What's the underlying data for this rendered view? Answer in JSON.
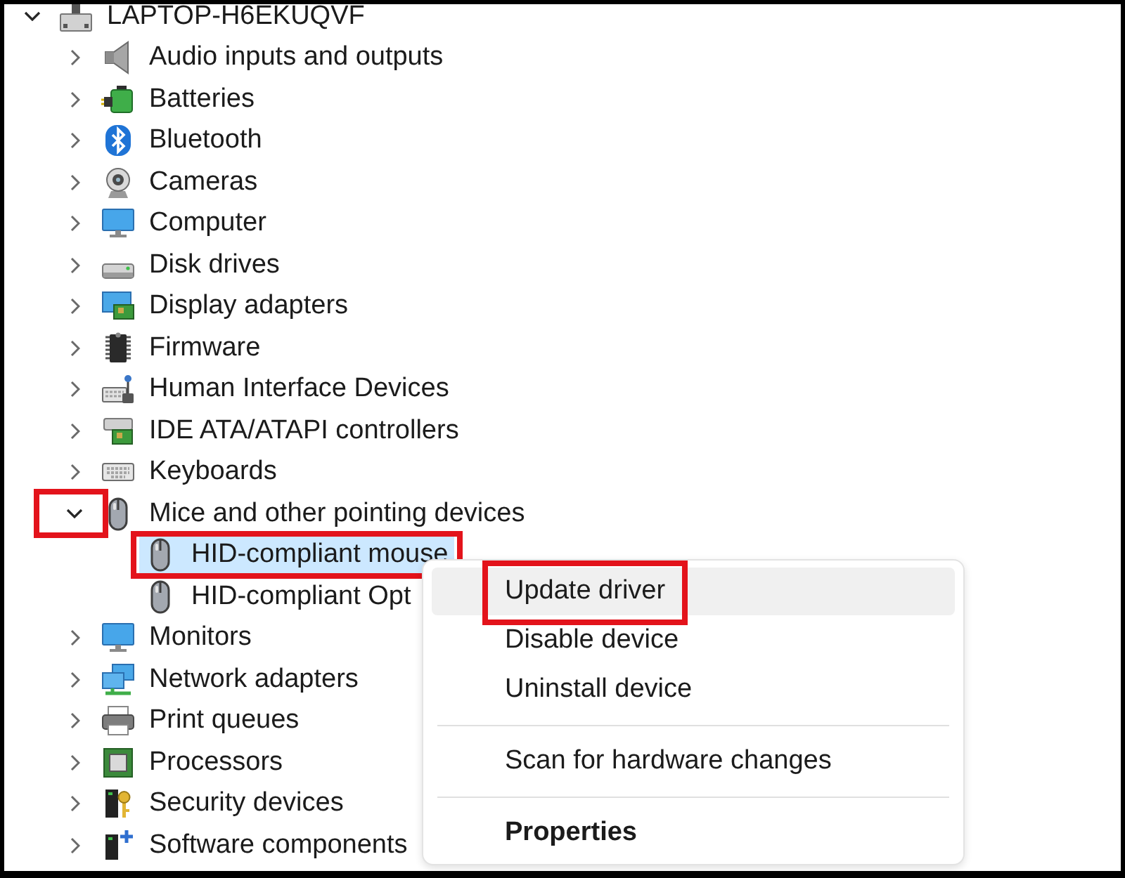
{
  "tree": {
    "label": "LAPTOP-H6EKUQVF",
    "expanded": true,
    "selected": false,
    "toggle_callout": false,
    "callout": false,
    "children": [
      {
        "label": "Audio inputs and outputs",
        "expanded": false,
        "selected": false,
        "toggle_callout": false,
        "callout": false
      },
      {
        "label": "Batteries",
        "expanded": false,
        "selected": false,
        "toggle_callout": false,
        "callout": false
      },
      {
        "label": "Bluetooth",
        "expanded": false,
        "selected": false,
        "toggle_callout": false,
        "callout": false
      },
      {
        "label": "Cameras",
        "expanded": false,
        "selected": false,
        "toggle_callout": false,
        "callout": false
      },
      {
        "label": "Computer",
        "expanded": false,
        "selected": false,
        "toggle_callout": false,
        "callout": false
      },
      {
        "label": "Disk drives",
        "expanded": false,
        "selected": false,
        "toggle_callout": false,
        "callout": false
      },
      {
        "label": "Display adapters",
        "expanded": false,
        "selected": false,
        "toggle_callout": false,
        "callout": false
      },
      {
        "label": "Firmware",
        "expanded": false,
        "selected": false,
        "toggle_callout": false,
        "callout": false
      },
      {
        "label": "Human Interface Devices",
        "expanded": false,
        "selected": false,
        "toggle_callout": false,
        "callout": false
      },
      {
        "label": "IDE ATA/ATAPI controllers",
        "expanded": false,
        "selected": false,
        "toggle_callout": false,
        "callout": false
      },
      {
        "label": "Keyboards",
        "expanded": false,
        "selected": false,
        "toggle_callout": false,
        "callout": false
      },
      {
        "label": "Mice and other pointing devices",
        "expanded": true,
        "selected": false,
        "toggle_callout": true,
        "callout": false,
        "children": [
          {
            "label": "HID-compliant mouse",
            "selected": true,
            "callout": true
          },
          {
            "label": "HID-compliant Opt",
            "selected": false,
            "callout": false
          }
        ]
      },
      {
        "label": "Monitors",
        "expanded": false,
        "selected": false,
        "toggle_callout": false,
        "callout": false
      },
      {
        "label": "Network adapters",
        "expanded": false,
        "selected": false,
        "toggle_callout": false,
        "callout": false
      },
      {
        "label": "Print queues",
        "expanded": false,
        "selected": false,
        "toggle_callout": false,
        "callout": false
      },
      {
        "label": "Processors",
        "expanded": false,
        "selected": false,
        "toggle_callout": false,
        "callout": false
      },
      {
        "label": "Security devices",
        "expanded": false,
        "selected": false,
        "toggle_callout": false,
        "callout": false
      },
      {
        "label": "Software components",
        "expanded": false,
        "selected": false,
        "toggle_callout": false,
        "callout": false
      }
    ]
  },
  "context_menu": {
    "items": [
      {
        "kind": "item",
        "label": "Update driver",
        "hovered": true,
        "default": false,
        "callout": true
      },
      {
        "kind": "item",
        "label": "Disable device",
        "hovered": false,
        "default": false,
        "callout": false
      },
      {
        "kind": "item",
        "label": "Uninstall device",
        "hovered": false,
        "default": false,
        "callout": false
      },
      {
        "kind": "separator"
      },
      {
        "kind": "item",
        "label": "Scan for hardware changes",
        "hovered": false,
        "default": false,
        "callout": false
      },
      {
        "kind": "separator"
      },
      {
        "kind": "item",
        "label": "Properties",
        "hovered": false,
        "default": true,
        "callout": false
      }
    ]
  }
}
